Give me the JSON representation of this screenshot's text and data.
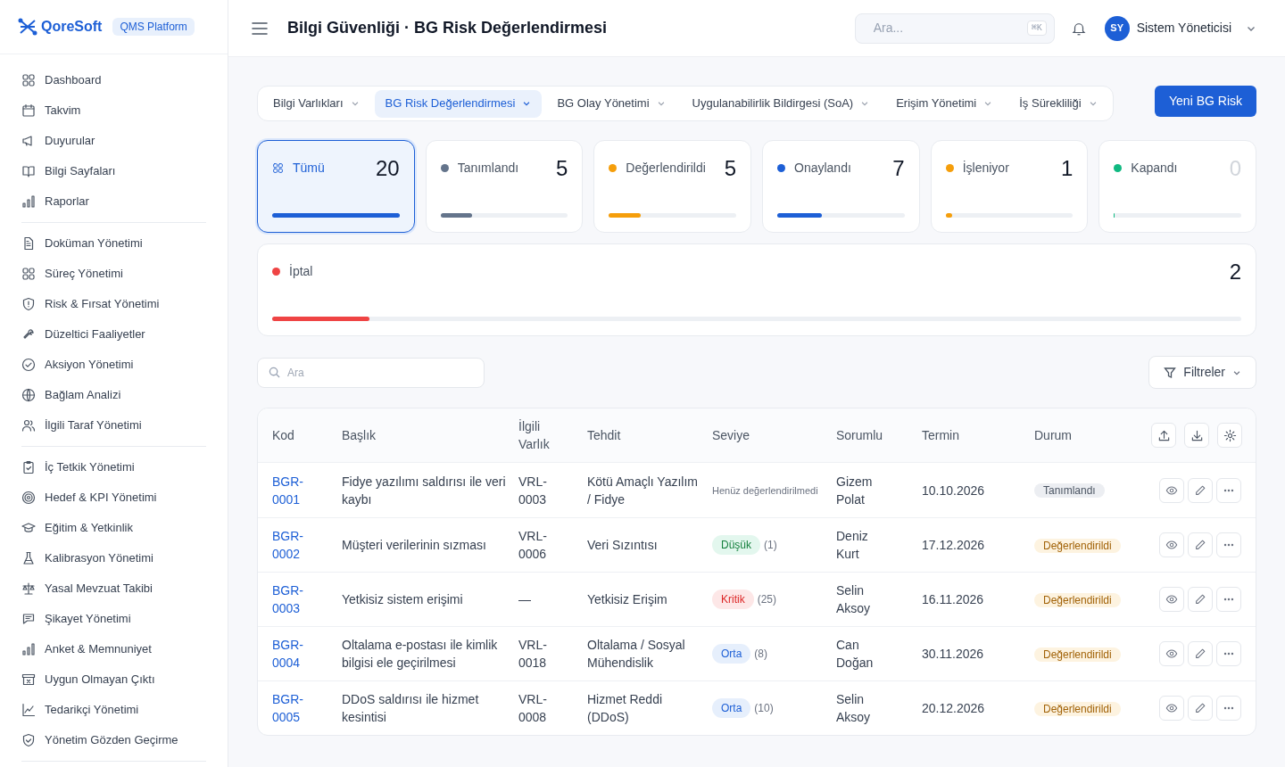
{
  "brand": {
    "name": "QoreSoft",
    "badge": "QMS Platform"
  },
  "sidebar": {
    "groups": [
      [
        "Dashboard",
        "Takvim",
        "Duyurular",
        "Bilgi Sayfaları",
        "Raporlar"
      ],
      [
        "Doküman Yönetimi",
        "Süreç Yönetimi",
        "Risk & Fırsat Yönetimi",
        "Düzeltici Faaliyetler",
        "Aksiyon Yönetimi",
        "Bağlam Analizi",
        "İlgili Taraf Yönetimi"
      ],
      [
        "İç Tetkik Yönetimi",
        "Hedef & KPI Yönetimi",
        "Eğitim & Yetkinlik",
        "Kalibrasyon Yönetimi",
        "Yasal Mevzuat Takibi",
        "Şikayet Yönetimi",
        "Anket & Memnuniyet",
        "Uygun Olmayan Çıktı",
        "Tedarikçi Yönetimi",
        "Yönetim Gözden Geçirme"
      ]
    ]
  },
  "header": {
    "title": "Bilgi Güvenliği · BG Risk Değerlendirmesi",
    "search": {
      "placeholder": "Ara...",
      "shortcut": "⌘K"
    },
    "user": {
      "initials": "SY",
      "name": "Sistem Yöneticisi"
    }
  },
  "tabs": [
    {
      "label": "Bilgi Varlıkları",
      "selected": false
    },
    {
      "label": "BG Risk Değerlendirmesi",
      "selected": true
    },
    {
      "label": "BG Olay Yönetimi",
      "selected": false
    },
    {
      "label": "Uygulanabilirlik Bildirgesi (SoA)",
      "selected": false
    },
    {
      "label": "Erişim Yönetimi",
      "selected": false
    },
    {
      "label": "İş Sürekliliği",
      "selected": false
    }
  ],
  "primary_button": "Yeni BG Risk",
  "status_cards": [
    {
      "kind": "all",
      "label": "Tümü",
      "count": "20",
      "level": 1,
      "selected": true,
      "color": "#1d5fd6"
    },
    {
      "kind": "status",
      "label": "Tanımlandı",
      "count": "5",
      "level": 0.25,
      "selected": false,
      "color": "#64748b"
    },
    {
      "kind": "status",
      "label": "Değerlendirildi",
      "count": "5",
      "level": 0.25,
      "selected": false,
      "color": "#f59e0b"
    },
    {
      "kind": "status",
      "label": "Onaylandı",
      "count": "7",
      "level": 0.35,
      "selected": false,
      "color": "#1d5fd6"
    },
    {
      "kind": "status",
      "label": "İşleniyor",
      "count": "1",
      "level": 0.05,
      "selected": false,
      "color": "#f59e0b"
    },
    {
      "kind": "status",
      "label": "Kapandı",
      "count": "0",
      "level": 0,
      "selected": false,
      "color": "#10b981"
    },
    {
      "kind": "status",
      "label": "İptal",
      "count": "2",
      "level": 0.1,
      "selected": false,
      "color": "#ef4444"
    }
  ],
  "search": {
    "placeholder": "Ara"
  },
  "filter_button": "Filtreler",
  "table": {
    "columns": [
      "Kod",
      "Başlık",
      "İlgili Varlık",
      "Tehdit",
      "Seviye",
      "Sorumlu",
      "Termin",
      "Durum"
    ],
    "rows": [
      {
        "code": "BGR-0001",
        "title": "Fidye yazılımı saldırısı ile veri kaybı",
        "asset": "VRL-0003",
        "threat": "Kötü Amaçlı Yazılım / Fidye",
        "level": {
          "kind": "none",
          "label": "Henüz değerlendirilmedi"
        },
        "owner": "Gizem Polat",
        "due": "10.10.2026",
        "status": {
          "kind": "defined",
          "label": "Tanımlandı"
        }
      },
      {
        "code": "BGR-0002",
        "title": "Müşteri verilerinin sızması",
        "asset": "VRL-0006",
        "threat": "Veri Sızıntısı",
        "level": {
          "kind": "low",
          "label": "Düşük",
          "score": "(1)"
        },
        "owner": "Deniz Kurt",
        "due": "17.12.2026",
        "status": {
          "kind": "evaluated",
          "label": "Değerlendirildi"
        }
      },
      {
        "code": "BGR-0003",
        "title": "Yetkisiz sistem erişimi",
        "asset": "—",
        "threat": "Yetkisiz Erişim",
        "level": {
          "kind": "critical",
          "label": "Kritik",
          "score": "(25)"
        },
        "owner": "Selin Aksoy",
        "due": "16.11.2026",
        "status": {
          "kind": "evaluated",
          "label": "Değerlendirildi"
        }
      },
      {
        "code": "BGR-0004",
        "title": "Oltalama e-postası ile kimlik bilgisi ele geçirilmesi",
        "asset": "VRL-0018",
        "threat": "Oltalama / Sosyal Mühendislik",
        "level": {
          "kind": "medium",
          "label": "Orta",
          "score": "(8)"
        },
        "owner": "Can Doğan",
        "due": "30.11.2026",
        "status": {
          "kind": "evaluated",
          "label": "Değerlendirildi"
        }
      },
      {
        "code": "BGR-0005",
        "title": "DDoS saldırısı ile hizmet kesintisi",
        "asset": "VRL-0008",
        "threat": "Hizmet Reddi (DDoS)",
        "level": {
          "kind": "medium",
          "label": "Orta",
          "score": "(10)"
        },
        "owner": "Selin Aksoy",
        "due": "20.12.2026",
        "status": {
          "kind": "evaluated",
          "label": "Değerlendirildi"
        }
      }
    ]
  }
}
